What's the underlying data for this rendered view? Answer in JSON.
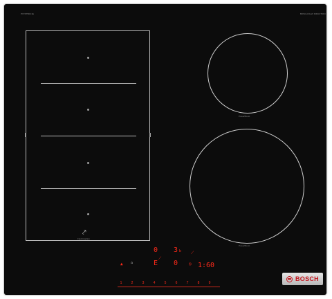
{
  "panel": {
    "model_label": "PXY675DC1E",
    "tagline": "BOSCH FLEX INDUCTION"
  },
  "zones": {
    "flex_zone_label": "FlexInduction",
    "small_burner_label": "PowerBoost",
    "large_burner_label": "PowerBoost"
  },
  "controls": {
    "zone1_level": "0",
    "zone2_level": "3",
    "zone2_suffix": "b",
    "zone3_level": "E",
    "zone4_level": "0",
    "timer_value": "1:60",
    "timer_icon": "clock-icon",
    "flex_icon": "flex-icon",
    "power_icon": "power-icon",
    "scale": [
      "1",
      "2",
      "3",
      "4",
      "5",
      "6",
      "7",
      "8",
      "9"
    ]
  },
  "badge": {
    "brand": "BOSCH"
  },
  "colors": {
    "display_red": "#ff2a1a",
    "glass": "#0c0c0c",
    "brand_red": "#c4141c"
  }
}
